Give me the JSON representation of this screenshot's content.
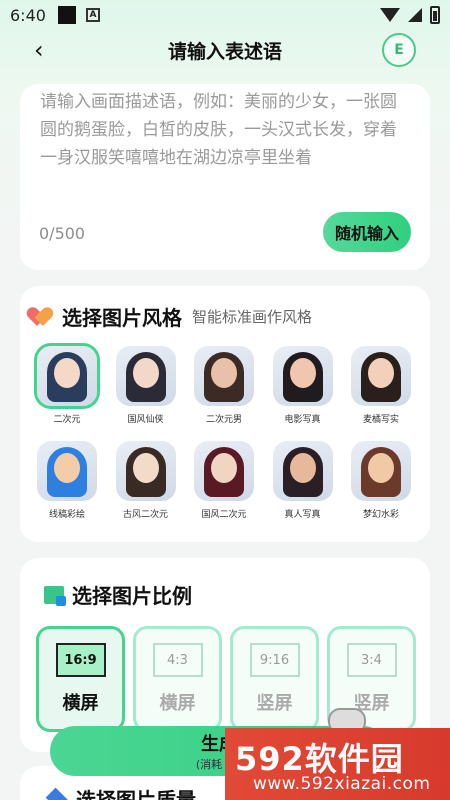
{
  "status": {
    "time": "6:40",
    "a_icon": "A"
  },
  "nav": {
    "back": "‹",
    "title": "请输入表述语",
    "badge": "E"
  },
  "prompt": {
    "text": "请输入画面描述语，例如：美丽的少女，一张圆圆的鹅蛋脸，白皙的皮肤，一头汉式长发，穿着一身汉服笑嘻嘻地在湖边凉亭里坐着",
    "count": "0/500",
    "random_button": "随机输入"
  },
  "style_section": {
    "title": "选择图片风格",
    "subtitle": "智能标准画作风格",
    "items": [
      {
        "label": "二次元",
        "selected": true,
        "colors": [
          "#2b3d5c",
          "#f5d9c7"
        ]
      },
      {
        "label": "国风仙侠",
        "selected": false,
        "colors": [
          "#2b2b38",
          "#f1d8c9"
        ]
      },
      {
        "label": "二次元男",
        "selected": false,
        "colors": [
          "#3b2b24",
          "#e7c1a8"
        ]
      },
      {
        "label": "电影写真",
        "selected": false,
        "colors": [
          "#1f1b1f",
          "#f0c7ae"
        ]
      },
      {
        "label": "麦橘写实",
        "selected": false,
        "colors": [
          "#2a1f1a",
          "#f2d0bc"
        ]
      },
      {
        "label": "线稿彩绘",
        "selected": false,
        "colors": [
          "#2d7fe0",
          "#f2cda8"
        ]
      },
      {
        "label": "古风二次元",
        "selected": false,
        "colors": [
          "#3a2a24",
          "#f3dcc7"
        ]
      },
      {
        "label": "国风二次元",
        "selected": false,
        "colors": [
          "#5a1a24",
          "#f0d5c2"
        ]
      },
      {
        "label": "真人写真",
        "selected": false,
        "colors": [
          "#2a1f27",
          "#e8b89a"
        ]
      },
      {
        "label": "梦幻水彩",
        "selected": false,
        "colors": [
          "#6b3a2a",
          "#f1c9a5"
        ]
      }
    ]
  },
  "ratio_section": {
    "title": "选择图片比例",
    "items": [
      {
        "ratio": "16:9",
        "label": "横屏",
        "selected": true
      },
      {
        "ratio": "4:3",
        "label": "横屏",
        "selected": false
      },
      {
        "ratio": "9:16",
        "label": "竖屏",
        "selected": false
      },
      {
        "ratio": "3:4",
        "label": "竖屏",
        "selected": false
      }
    ]
  },
  "generate": {
    "label": "生成",
    "sub": "(消耗 ***"
  },
  "quality_section": {
    "title": "选择图片质量"
  },
  "watermark": {
    "main": "592软件园",
    "sub": "www.592xiazai.com"
  }
}
